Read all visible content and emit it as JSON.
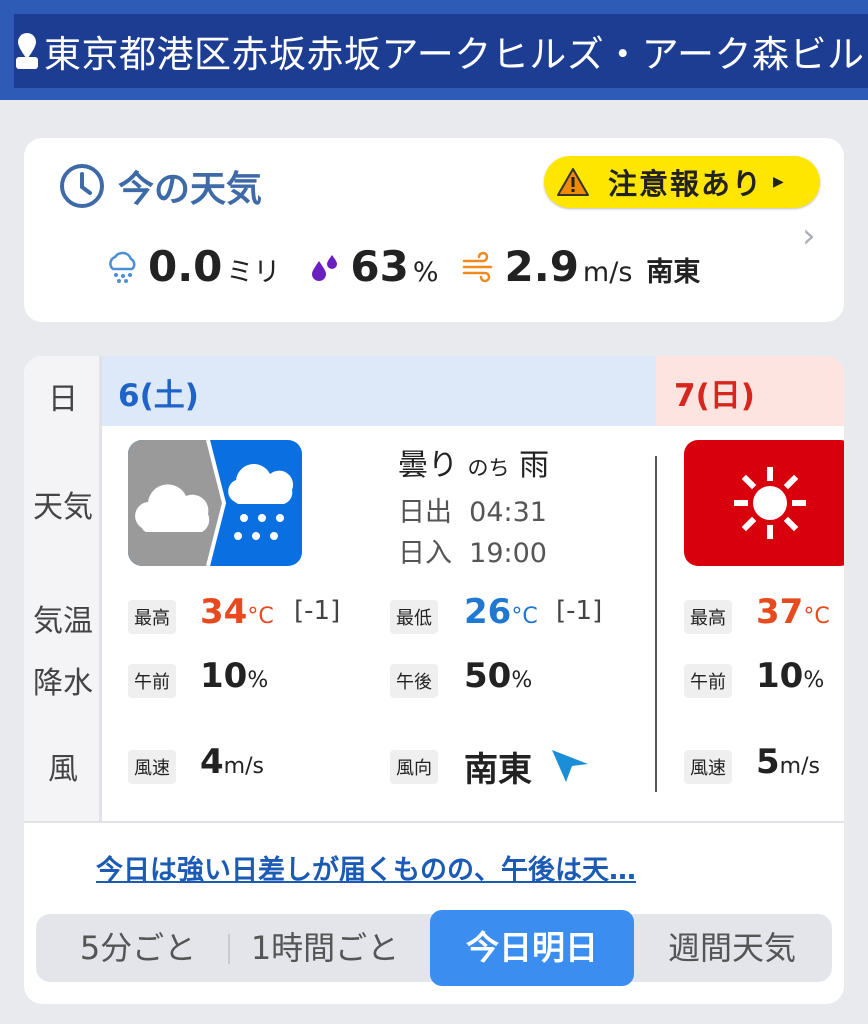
{
  "header": {
    "address": "東京都港区赤坂赤坂アークヒルズ・アーク森ビル"
  },
  "now": {
    "title": "今の天気",
    "alert_label": "注意報あり",
    "precip_value": "0.0",
    "precip_unit": "ミリ",
    "humidity_value": "63",
    "humidity_unit": "%",
    "wind_value": "2.9",
    "wind_unit": "m/s",
    "wind_dir": "南東"
  },
  "forecast": {
    "row_labels": {
      "day": "日",
      "weather": "天気",
      "temp": "気温",
      "precip": "降水",
      "wind": "風"
    },
    "today": {
      "day": "6(土)",
      "weather_main": "曇り",
      "weather_then": "のち",
      "weather_after": "雨",
      "sunrise_label": "日出",
      "sunrise": "04:31",
      "sunset_label": "日入",
      "sunset": "19:00",
      "high_tag": "最高",
      "high": "34",
      "high_unit": "°C",
      "high_delta": "[-1]",
      "low_tag": "最低",
      "low": "26",
      "low_unit": "°C",
      "low_delta": "[-1]",
      "am_tag": "午前",
      "am": "10",
      "am_unit": "%",
      "pm_tag": "午後",
      "pm": "50",
      "pm_unit": "%",
      "wspd_tag": "風速",
      "wspd": "4",
      "wspd_unit": "m/s",
      "wdir_tag": "風向",
      "wdir": "南東"
    },
    "tomorrow": {
      "day": "7(日)",
      "high_tag": "最高",
      "high": "37",
      "high_unit": "°C",
      "am_tag": "午前",
      "am": "10",
      "am_unit": "%",
      "wspd_tag": "風速",
      "wspd": "5",
      "wspd_unit": "m/s"
    },
    "comment": "今日は強い日差しが届くものの、午後は天…"
  },
  "tabs": [
    "5分ごと",
    "1時間ごと",
    "今日明日",
    "週間天気"
  ],
  "colors": {
    "accent": "#3b8ef0",
    "high": "#e8491d",
    "low": "#1f78d1",
    "header": "#1d3d92"
  }
}
